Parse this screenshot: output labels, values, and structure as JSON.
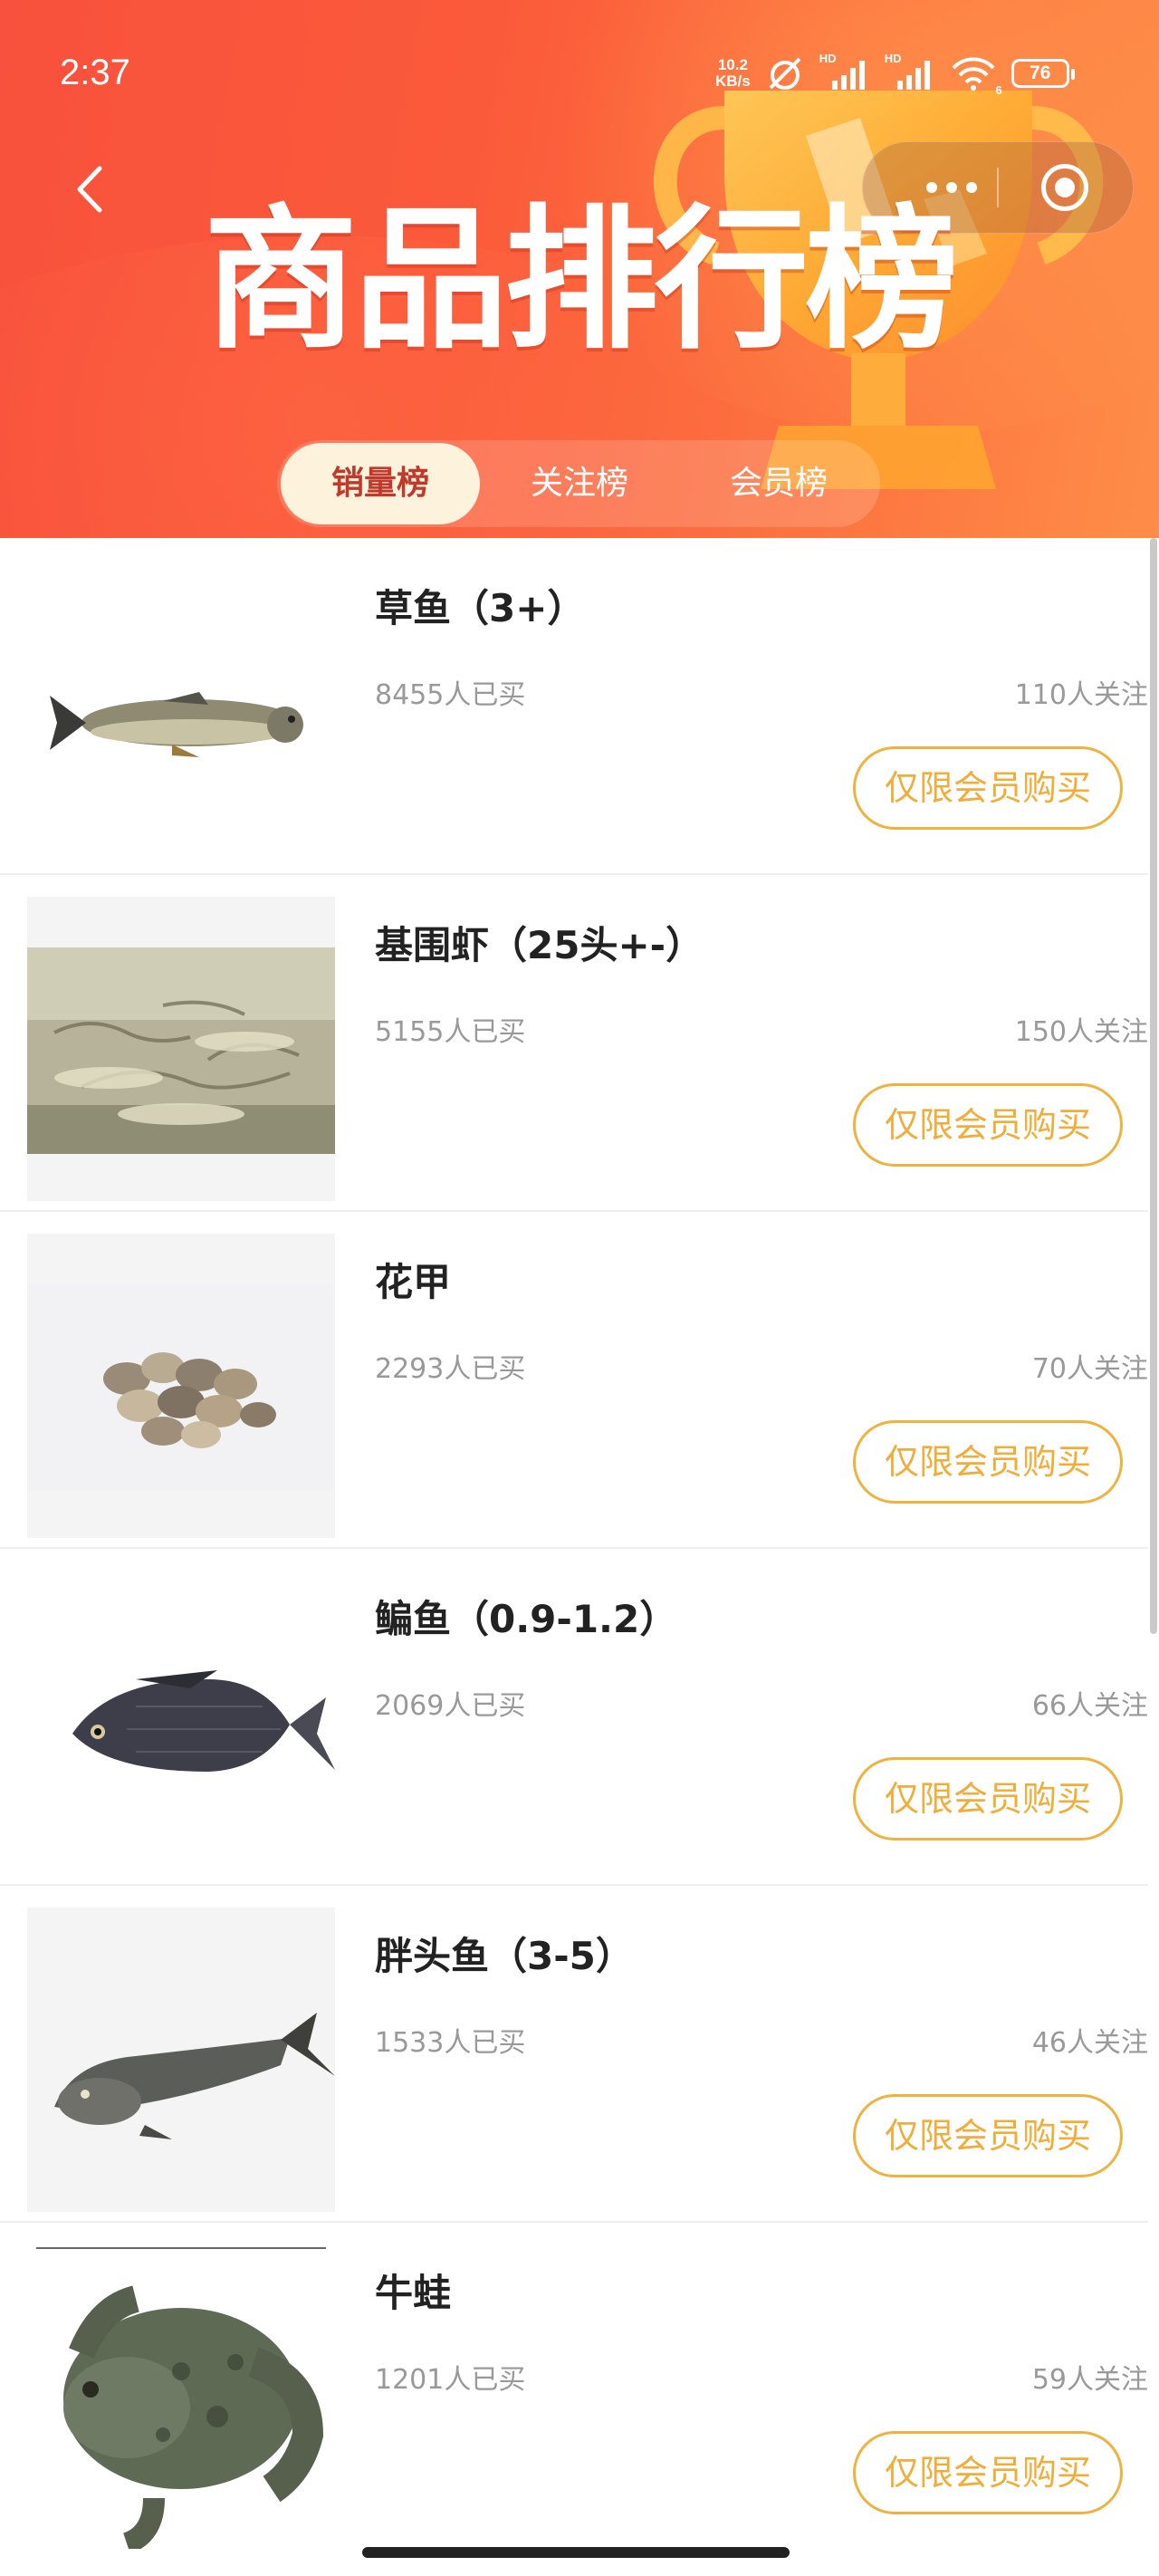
{
  "status_bar": {
    "time": "2:37",
    "net_speed_value": "10.2",
    "net_speed_unit": "KB/s",
    "signal_label_1": "HD",
    "signal_label_2": "HD",
    "wifi_badge": "6",
    "battery": "76"
  },
  "header": {
    "title": "商品排行榜",
    "back_icon": "chevron-left-icon",
    "more_icon": "more-dots-icon",
    "close_icon": "target-close-icon",
    "background_colors": [
      "#f8513d",
      "#fe8d48"
    ]
  },
  "tabs": [
    {
      "label": "销量榜",
      "active": true
    },
    {
      "label": "关注榜",
      "active": false
    },
    {
      "label": "会员榜",
      "active": false
    }
  ],
  "colors": {
    "accent": "#f0ad3a",
    "active_tab_bg": "#fdf3dc",
    "active_tab_text": "#c0392b",
    "muted_text": "#999999"
  },
  "items": [
    {
      "name": "草鱼（3+）",
      "sold": "8455人已买",
      "follow": "110人关注",
      "button": "仅限会员购买",
      "image": "grass-carp-image"
    },
    {
      "name": "基围虾（25头+-）",
      "sold": "5155人已买",
      "follow": "150人关注",
      "button": "仅限会员购买",
      "image": "shrimp-image"
    },
    {
      "name": "花甲",
      "sold": "2293人已买",
      "follow": "70人关注",
      "button": "仅限会员购买",
      "image": "clams-image"
    },
    {
      "name": "鳊鱼（0.9-1.2）",
      "sold": "2069人已买",
      "follow": "66人关注",
      "button": "仅限会员购买",
      "image": "bream-image"
    },
    {
      "name": "胖头鱼（3-5）",
      "sold": "1533人已买",
      "follow": "46人关注",
      "button": "仅限会员购买",
      "image": "bighead-carp-image"
    },
    {
      "name": "牛蛙",
      "sold": "1201人已买",
      "follow": "59人关注",
      "button": "仅限会员购买",
      "image": "bullfrog-image"
    }
  ]
}
